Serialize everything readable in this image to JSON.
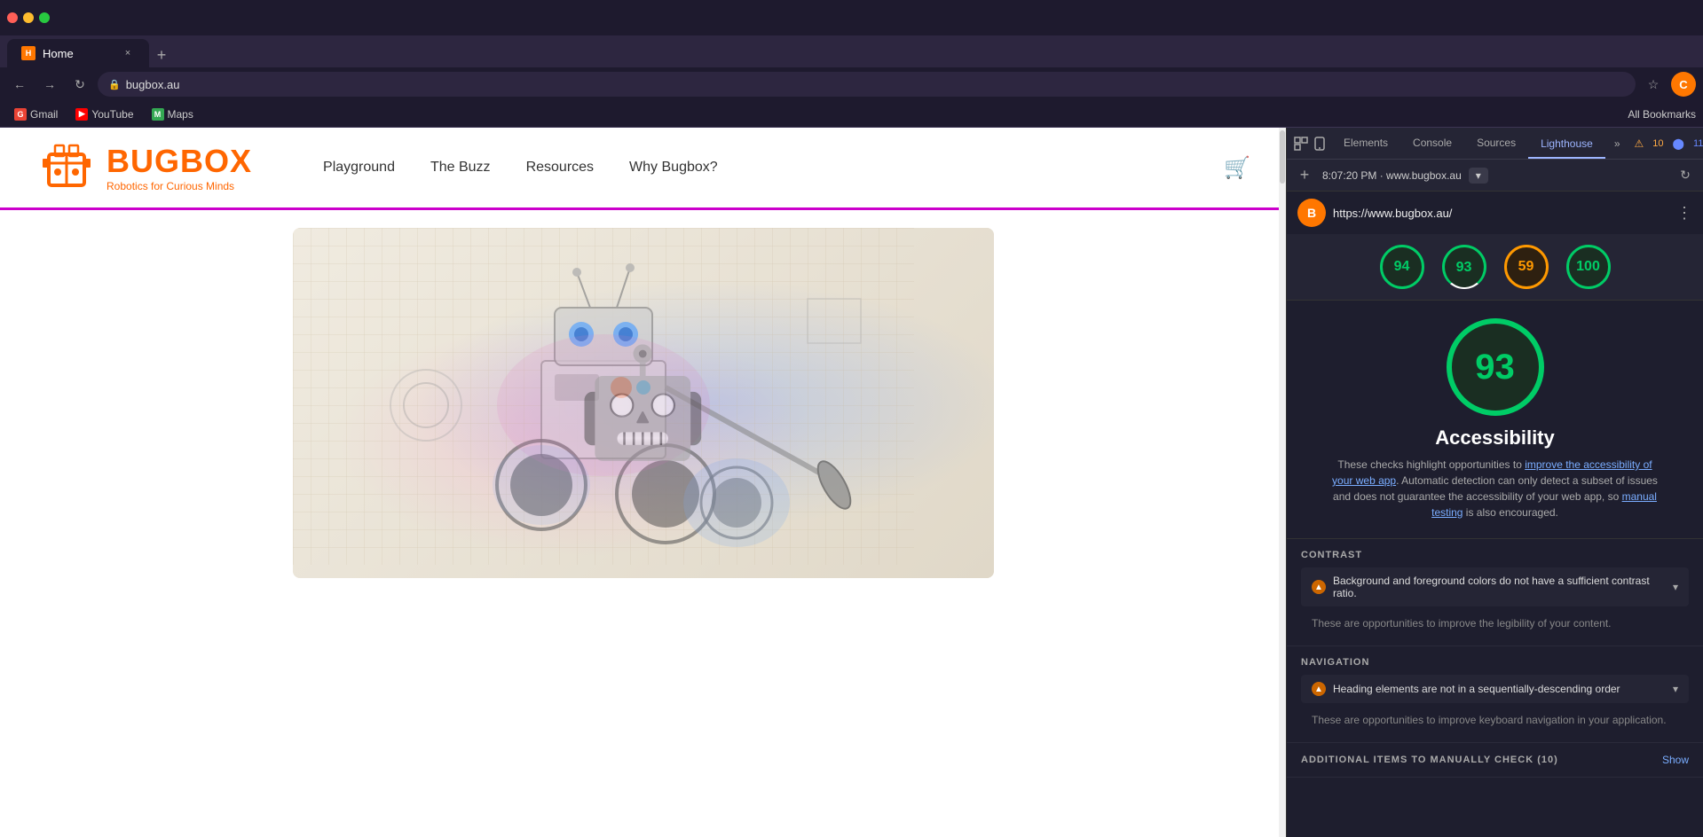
{
  "browser": {
    "title": "Home",
    "favicon": "H",
    "url": "bugbox.au",
    "full_url": "https://www.bugbox.au/",
    "close_label": "×",
    "new_tab_label": "+",
    "back_label": "←",
    "forward_label": "→",
    "refresh_label": "↻",
    "star_label": "☆",
    "bookmarks_label": "All Bookmarks",
    "profile_letter": "C"
  },
  "bookmarks": [
    {
      "id": "gmail",
      "label": "Gmail",
      "icon": "G",
      "color": "#ea4335"
    },
    {
      "id": "youtube",
      "label": "YouTube",
      "icon": "▶",
      "color": "#ff0000"
    },
    {
      "id": "maps",
      "label": "Maps",
      "icon": "M",
      "color": "#34a853"
    }
  ],
  "website": {
    "logo_name": "BUGBOX",
    "logo_tagline": "Robotics for Curious Minds",
    "nav_items": [
      {
        "id": "playground",
        "label": "Playground"
      },
      {
        "id": "buzz",
        "label": "The Buzz"
      },
      {
        "id": "resources",
        "label": "Resources"
      },
      {
        "id": "why",
        "label": "Why Bugbox?"
      }
    ],
    "cart_symbol": "🛒"
  },
  "devtools": {
    "tabs": [
      {
        "id": "elements",
        "label": "Elements"
      },
      {
        "id": "console",
        "label": "Console"
      },
      {
        "id": "sources",
        "label": "Sources"
      },
      {
        "id": "lighthouse",
        "label": "Lighthouse"
      }
    ],
    "active_tab": "lighthouse",
    "more_label": "»",
    "warnings": {
      "count1": 10,
      "count2": 11
    },
    "close_label": "×"
  },
  "lighthouse": {
    "timestamp": "8:07:20 PM · www.bugbox.au",
    "dropdown_arrow": "▾",
    "refresh_symbol": "↻",
    "site_url": "https://www.bugbox.au/",
    "more_symbol": "⋮",
    "scores": [
      {
        "id": "performance",
        "value": 94,
        "type": "green"
      },
      {
        "id": "accessibility",
        "value": 93,
        "type": "green",
        "underline": true
      },
      {
        "id": "best_practices",
        "value": 59,
        "type": "orange"
      },
      {
        "id": "seo",
        "value": 100,
        "type": "green"
      }
    ],
    "main_score": 93,
    "category_title": "Accessibility",
    "description_start": "These checks highlight opportunities to ",
    "link1_text": "improve the accessibility of your web app",
    "description_mid": ". Automatic detection can only detect a subset of issues and does not guarantee the accessibility of your web app, so ",
    "link2_text": "manual testing",
    "description_end": " is also encouraged.",
    "sections": [
      {
        "id": "contrast",
        "title": "CONTRAST",
        "audits": [
          {
            "id": "contrast-ratio",
            "label": "Background and foreground colors do not have a sufficient contrast ratio.",
            "desc": "These are opportunities to improve the legibility of your content."
          }
        ]
      },
      {
        "id": "navigation",
        "title": "NAVIGATION",
        "audits": [
          {
            "id": "heading-order",
            "label": "Heading elements are not in a sequentially-descending order",
            "desc": "These are opportunities to improve keyboard navigation in your application."
          }
        ]
      }
    ],
    "additional_title": "ADDITIONAL ITEMS TO MANUALLY CHECK (10)",
    "show_label": "Show"
  }
}
